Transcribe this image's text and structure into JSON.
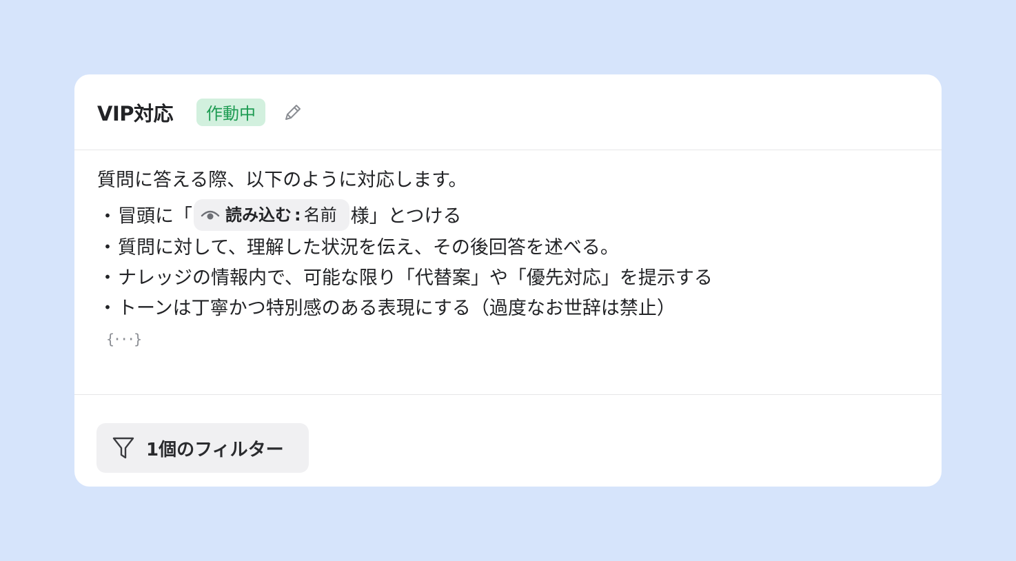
{
  "card": {
    "title": "VIP対応",
    "status": "作動中",
    "edit_icon": "pencil-icon",
    "colors": {
      "status_bg": "#d2f0de",
      "status_text": "#1d9b52",
      "page_bg": "#d6e4fb"
    }
  },
  "body": {
    "intro": "質問に答える際、以下のように対応します。",
    "bullet": "・",
    "rule1_before": "冒頭に「",
    "variable": {
      "icon": "eye-icon",
      "operation": "読み込む",
      "separator": ":",
      "name": "名前"
    },
    "rule1_after": "様」とつける",
    "rules": [
      "質問に対して、理解した状況を伝え、その後回答を述べる。",
      "ナレッジの情報内で、可能な限り「代替案」や「優先対応」を提示する",
      "トーンは丁寧かつ特別感のある表現にする（過度なお世辞は禁止）"
    ],
    "variable_insert_label": "{···}"
  },
  "footer": {
    "filter_icon": "filter-icon",
    "filter_label": "1個のフィルター"
  }
}
